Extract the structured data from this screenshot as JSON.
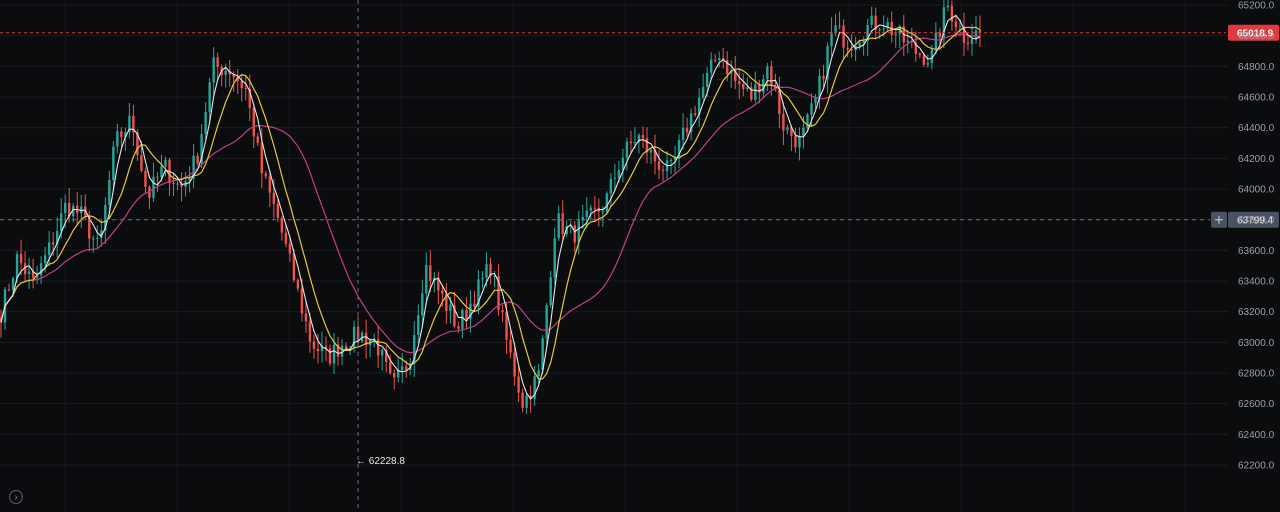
{
  "chart_data": {
    "type": "candlestick",
    "y_axis": {
      "ticks": [
        "65200.0",
        "65000.0",
        "64800.0",
        "64600.0",
        "64400.0",
        "64200.0",
        "64000.0",
        "63800.0",
        "63600.0",
        "63400.0",
        "63200.0",
        "63000.0",
        "62800.0",
        "62600.0",
        "62400.0",
        "62200.0"
      ],
      "ylim": [
        62100,
        65260
      ],
      "position": "right"
    },
    "grid": true,
    "current_price": {
      "value": 65018.9,
      "label": "65018.9",
      "color": "#e0393e"
    },
    "crosshair_price": {
      "value": 63799.4,
      "label": "63799.4",
      "color": "#4a5262"
    },
    "low_marker": {
      "value": 62228.8,
      "label": "62228.8"
    },
    "colors": {
      "up": "#26a69a",
      "down": "#ef5350",
      "ma_fast": "#e6e6e6",
      "ma_mid": "#e8c840",
      "ma_slow": "#c0408a",
      "background": "#0b0c0e"
    },
    "price_path": [
      63200,
      63550,
      63380,
      63620,
      63900,
      63820,
      63600,
      64300,
      64450,
      63950,
      64150,
      64000,
      64200,
      64800,
      64780,
      64650,
      64100,
      63800,
      63400,
      63000,
      62900,
      63000,
      63050,
      63000,
      62700,
      62880,
      63500,
      63300,
      63100,
      63300,
      63500,
      63000,
      62600,
      62800,
      63800,
      63700,
      63800,
      63900,
      64200,
      64350,
      64200,
      64100,
      64400,
      64650,
      64900,
      64700,
      64600,
      64800,
      64400,
      64300,
      64600,
      65050,
      64950,
      65050,
      65100,
      65000,
      64900,
      64850,
      65200,
      65000,
      65018.9
    ]
  },
  "ui": {
    "bottom_button_icon": "chevron-right-circle-icon",
    "bottom_button_glyph": "›"
  }
}
